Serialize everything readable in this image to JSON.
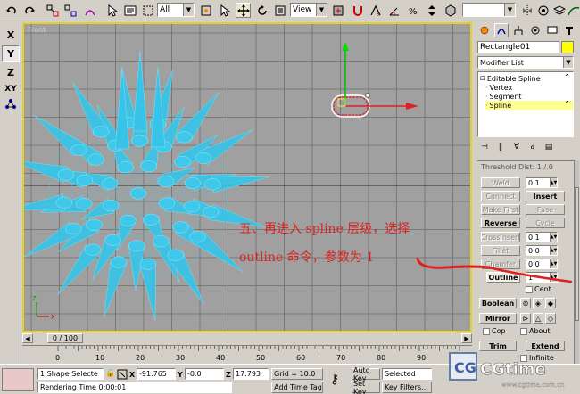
{
  "toolbar": {
    "selection_filter": "All",
    "reference_coord": "View",
    "named_selection": ""
  },
  "axis": {
    "x": "X",
    "y": "Y",
    "z": "Z",
    "xy": "XY"
  },
  "viewport": {
    "label": "Front"
  },
  "command_panel": {
    "object_name": "Rectangle01",
    "object_color": "#ffff00",
    "modifier_list": "Modifier List",
    "stack": [
      {
        "label": "Editable Spline",
        "level": 0
      },
      {
        "label": "Vertex",
        "level": 1
      },
      {
        "label": "Segment",
        "level": 1
      },
      {
        "label": "Spline",
        "level": 1,
        "selected": true
      }
    ],
    "rollout": {
      "threshold_label": "Threshold Dist: 1 /.0",
      "weld": "Weld",
      "weld_value": "0.1",
      "connect": "Connect",
      "insert": "Insert",
      "make_first": "Make First",
      "fuse": "Fuse",
      "reverse": "Reverse",
      "cycle": "Cycle",
      "crossinsert": "CrossInsert",
      "crossinsert_value": "0.1",
      "fillet": "Fillet",
      "fillet_value": "0.0",
      "chamfer": "Chamfer",
      "chamfer_value": "0.0",
      "outline": "Outline",
      "outline_value": "1",
      "center": "Cent",
      "boolean": "Boolean",
      "mirror": "Mirror",
      "copy": "Cop",
      "about": "About",
      "trim": "Trim",
      "extend": "Extend",
      "infinite": "Infinite"
    }
  },
  "time_slider": {
    "label": "0 / 100",
    "ticks": [
      "0",
      "10",
      "20",
      "30",
      "40",
      "50",
      "60",
      "70",
      "80",
      "90"
    ]
  },
  "status": {
    "selection": "1 Shape Selecte",
    "x_label": "X",
    "x_value": "-91.765",
    "y_label": "Y",
    "y_value": "-0.0",
    "z_label": "Z",
    "z_value": "17.793",
    "grid": "Grid = 10.0",
    "rendering_time": "Rendering Time  0:00:01",
    "add_time_tag": "Add Time Tag",
    "auto_key": "Auto Key",
    "set_key": "Set Key",
    "selected": "Selected",
    "key_filters": "Key Filters..."
  },
  "annotation": {
    "line1": "五、再进入 spline 层级，选择",
    "line2": "outline 命令，参数为 1",
    "color": "#e02020"
  },
  "watermark": {
    "brand": "CGtime",
    "url": "www.cgtime.com.cn"
  }
}
